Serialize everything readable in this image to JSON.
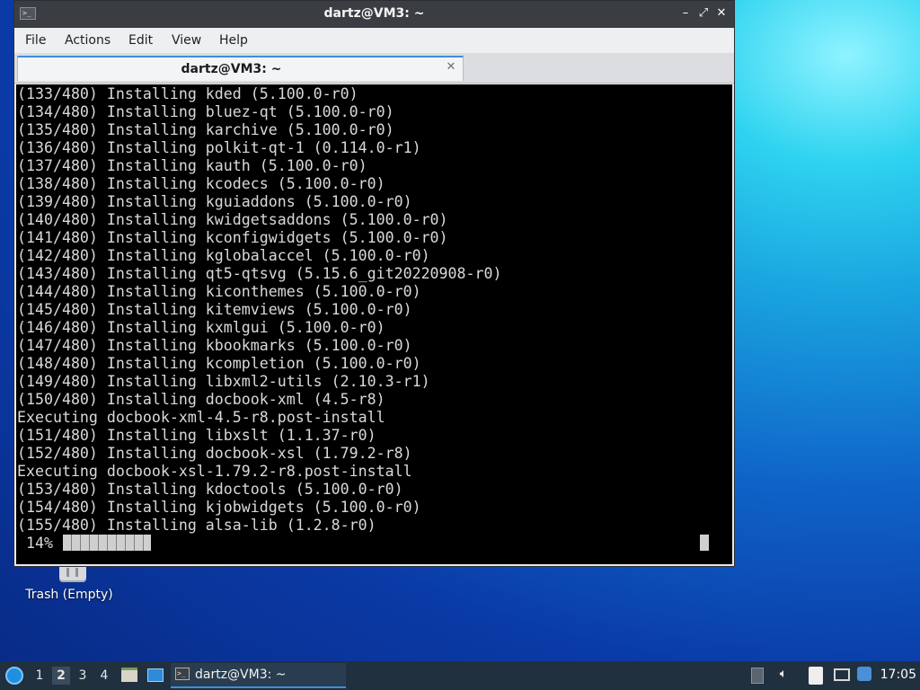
{
  "desktop": {
    "trash_label": "Trash (Empty)"
  },
  "window": {
    "title": "dartz@VM3: ~",
    "controls": {
      "minimize": "–",
      "maximize": "⤢",
      "close": "✕"
    },
    "menu": [
      "File",
      "Actions",
      "Edit",
      "View",
      "Help"
    ],
    "tab_title": "dartz@VM3: ~",
    "tab_close": "✕"
  },
  "terminal": {
    "lines": [
      "(133/480) Installing kded (5.100.0-r0)",
      "(134/480) Installing bluez-qt (5.100.0-r0)",
      "(135/480) Installing karchive (5.100.0-r0)",
      "(136/480) Installing polkit-qt-1 (0.114.0-r1)",
      "(137/480) Installing kauth (5.100.0-r0)",
      "(138/480) Installing kcodecs (5.100.0-r0)",
      "(139/480) Installing kguiaddons (5.100.0-r0)",
      "(140/480) Installing kwidgetsaddons (5.100.0-r0)",
      "(141/480) Installing kconfigwidgets (5.100.0-r0)",
      "(142/480) Installing kglobalaccel (5.100.0-r0)",
      "(143/480) Installing qt5-qtsvg (5.15.6_git20220908-r0)",
      "(144/480) Installing kiconthemes (5.100.0-r0)",
      "(145/480) Installing kitemviews (5.100.0-r0)",
      "(146/480) Installing kxmlgui (5.100.0-r0)",
      "(147/480) Installing kbookmarks (5.100.0-r0)",
      "(148/480) Installing kcompletion (5.100.0-r0)",
      "(149/480) Installing libxml2-utils (2.10.3-r1)",
      "(150/480) Installing docbook-xml (4.5-r8)",
      "Executing docbook-xml-4.5-r8.post-install",
      "(151/480) Installing libxslt (1.1.37-r0)",
      "(152/480) Installing docbook-xsl (1.79.2-r8)",
      "Executing docbook-xsl-1.79.2-r8.post-install",
      "(153/480) Installing kdoctools (5.100.0-r0)",
      "(154/480) Installing kjobwidgets (5.100.0-r0)",
      "(155/480) Installing alsa-lib (1.2.8-r0)"
    ],
    "progress_text": " 14%",
    "progress_percent": 14
  },
  "taskbar": {
    "workspaces": [
      "1",
      "2",
      "3",
      "4"
    ],
    "active_workspace": "2",
    "task_label": "dartz@VM3: ~",
    "clock": "17:05"
  },
  "colors": {
    "accent": "#3d8ee0",
    "terminal_bg": "#000000",
    "terminal_fg": "#d9d9d9",
    "titlebar": "#3a3e43",
    "taskbar": "#20303f"
  }
}
